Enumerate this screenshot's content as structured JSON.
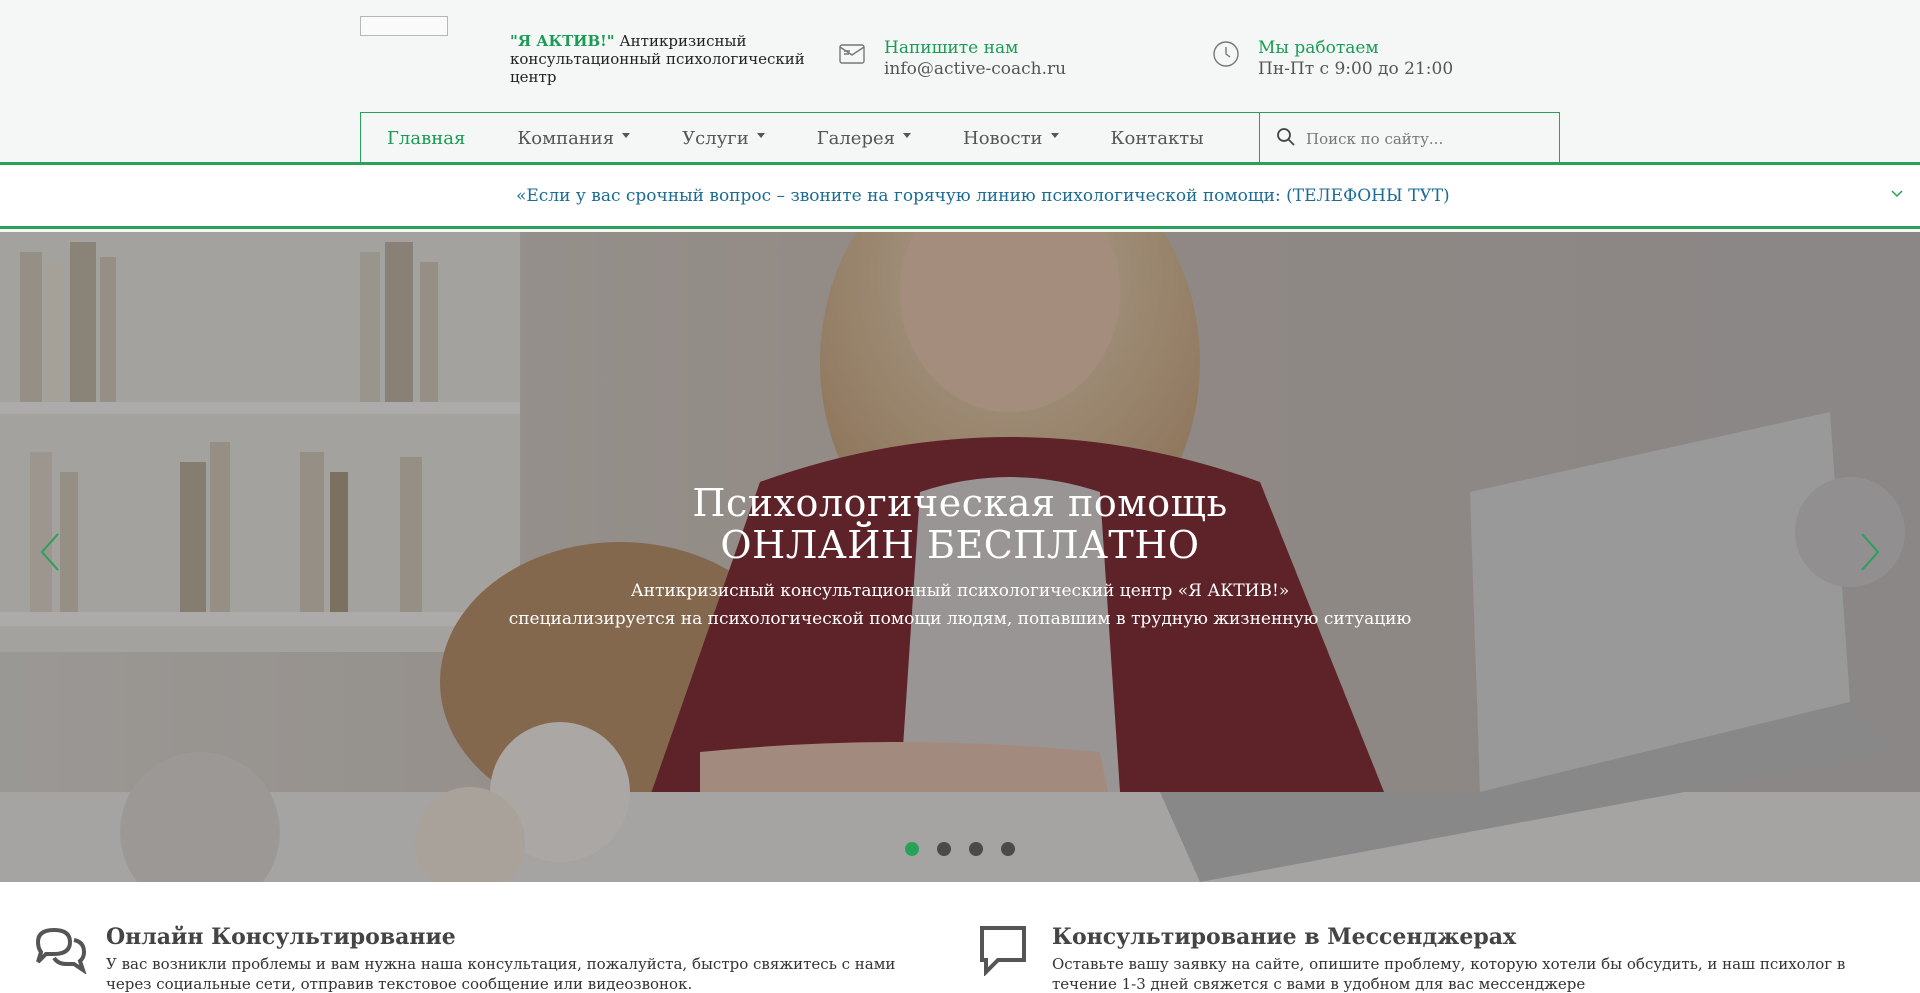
{
  "header": {
    "brand_accent": "\"Я АКТИВ!\"",
    "brand_text": " Антикризисный консультационный психологический центр",
    "email": {
      "label": "Напишите нам",
      "value": "info@active-coach.ru",
      "icon": "envelope-icon"
    },
    "hours": {
      "label": "Мы работаем",
      "value": "Пн-Пт с 9:00 до 21:00",
      "icon": "clock-icon"
    }
  },
  "nav": {
    "items": [
      {
        "label": "Главная",
        "active": true,
        "dropdown": false
      },
      {
        "label": "Компания",
        "active": false,
        "dropdown": true
      },
      {
        "label": "Услуги",
        "active": false,
        "dropdown": true
      },
      {
        "label": "Галерея",
        "active": false,
        "dropdown": true
      },
      {
        "label": "Новости",
        "active": false,
        "dropdown": true
      },
      {
        "label": "Контакты",
        "active": false,
        "dropdown": false
      }
    ],
    "search_placeholder": "Поиск по сайту..."
  },
  "announcement": {
    "text": "«Если у вас срочный вопрос – звоните на горячую линию психологической помощи: (ТЕЛЕФОНЫ ТУТ)"
  },
  "hero": {
    "title_line1": "Психологическая помощь",
    "title_line2": "ОНЛАЙН БЕСПЛАТНО",
    "sub_line1": "Антикризисный консультационный психологический центр «Я АКТИВ!»",
    "sub_line2": "специализируется на психологической помощи людям, попавшим в трудную жизненную ситуацию",
    "slides": 4,
    "active_slide": 1
  },
  "features": [
    {
      "title": "Онлайн Консультирование",
      "text": "У вас возникли проблемы и вам нужна наша консультация, пожалуйста, быстро свяжитесь с нами через социальные сети, отправив текстовое сообщение или видеозвонок.",
      "icon": "chat-bubbles-icon"
    },
    {
      "title": "Консультирование в Мессенджерах",
      "text": "Оставьте вашу заявку на сайте, опишите проблему, которую хотели бы обсудить, и наш психолог в течение 1-3 дней свяжется с вами в удобном для вас мессенджере",
      "icon": "message-bubble-icon"
    }
  ],
  "colors": {
    "accent": "#2aa15a",
    "link": "#1a6b95",
    "header_bg": "#f4f7f5"
  }
}
